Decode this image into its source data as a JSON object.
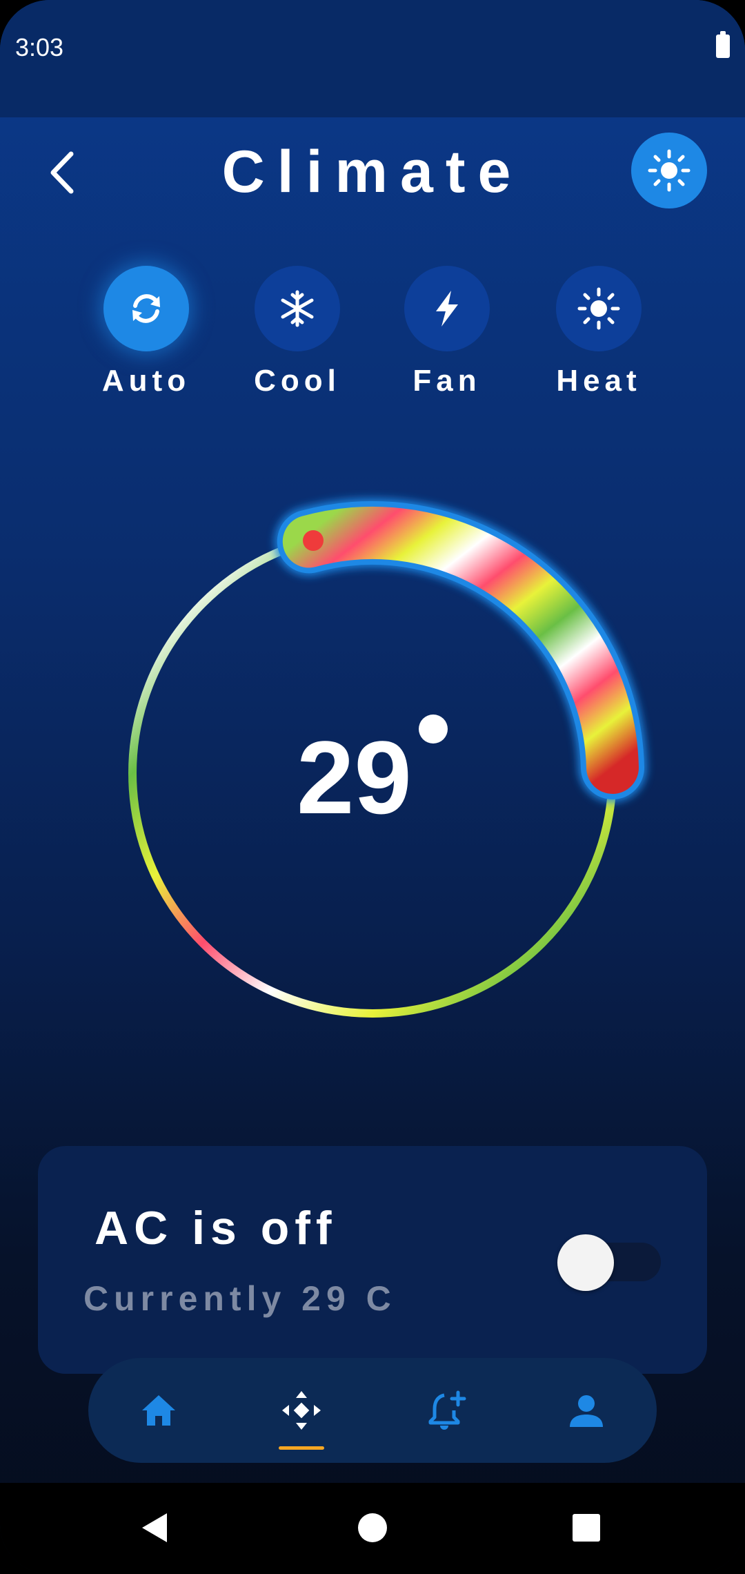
{
  "status_bar": {
    "time": "3:03"
  },
  "header": {
    "title": "Climate",
    "back_icon": "chevron-left-icon",
    "theme_icon": "sun-icon"
  },
  "modes": [
    {
      "label": "Auto",
      "icon": "sync-icon",
      "active": true
    },
    {
      "label": "Cool",
      "icon": "snowflake-icon",
      "active": false
    },
    {
      "label": "Fan",
      "icon": "bolt-icon",
      "active": false
    },
    {
      "label": "Heat",
      "icon": "sun-icon",
      "active": false
    }
  ],
  "thermostat": {
    "temperature": "29",
    "unit_symbol": "degree-dot"
  },
  "ac_card": {
    "title": "AC is off",
    "subtitle": "Currently 29 C",
    "power_on": false
  },
  "bottom_nav": {
    "items": [
      {
        "name": "home",
        "icon": "home-icon"
      },
      {
        "name": "controls",
        "icon": "gamepad-icon",
        "selected": true
      },
      {
        "name": "add-alarm",
        "icon": "bell-plus-icon"
      },
      {
        "name": "profile",
        "icon": "person-icon"
      }
    ]
  },
  "colors": {
    "accent": "#1e88e5",
    "mode_inactive": "#0d3f9a",
    "indicator": "#f5a623",
    "muted_text": "#7e8aa3"
  }
}
